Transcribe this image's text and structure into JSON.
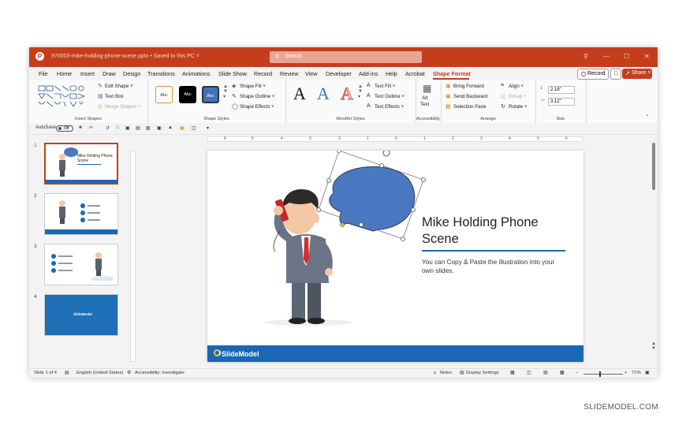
{
  "titlebar": {
    "logo": "P",
    "filename": "970003-mike-holding-phone-scene.pptx • Saved to this PC ˅",
    "search_placeholder": "Search",
    "window_buttons": [
      "⚲",
      "—",
      "☐",
      "✕"
    ]
  },
  "menu": {
    "items": [
      "File",
      "Home",
      "Insert",
      "Draw",
      "Design",
      "Transitions",
      "Animations",
      "Slide Show",
      "Record",
      "Review",
      "View",
      "Developer",
      "Add-ins",
      "Help",
      "Acrobat",
      "Shape Format"
    ],
    "active": "Shape Format",
    "record_label": "Record",
    "share_label": "Share ˅"
  },
  "ribbon": {
    "insert_shapes": {
      "label": "Insert Shapes",
      "edit_shape": "Edit Shape ˅",
      "text_box": "Text Box",
      "merge_shapes": "Merge Shapes ˅"
    },
    "shape_styles": {
      "label": "Shape Styles",
      "swatches": [
        "Abc",
        "Abc",
        "Abc"
      ],
      "shape_fill": "Shape Fill ˅",
      "shape_outline": "Shape Outline ˅",
      "shape_effects": "Shape Effects ˅"
    },
    "wordart": {
      "label": "WordArt Styles",
      "letters": [
        "A",
        "A",
        "A"
      ],
      "text_fill": "Text Fill ˅",
      "text_outline": "Text Outline ˅",
      "text_effects": "Text Effects ˅"
    },
    "accessibility": {
      "label": "Accessibility",
      "alt_text": "Alt\nText"
    },
    "arrange": {
      "label": "Arrange",
      "bring_forward": "Bring Forward",
      "send_backward": "Send Backward",
      "selection_pane": "Selection Pane",
      "align": "Align ˅",
      "group": "Group ˅",
      "rotate": "Rotate ˅"
    },
    "size": {
      "label": "Size",
      "height": "2.18\"",
      "width": "3.12\""
    }
  },
  "qat": {
    "autosave": "AutoSave",
    "toggle": "Off"
  },
  "thumbnails": [
    {
      "num": "1",
      "title": "Mike Holding Phone Scene"
    },
    {
      "num": "2"
    },
    {
      "num": "3"
    },
    {
      "num": "4",
      "brand": "SlideModel"
    }
  ],
  "ruler_marks": [
    "6",
    "5",
    "4",
    "3",
    "2",
    "1",
    "0",
    "1",
    "2",
    "3",
    "4",
    "5",
    "6"
  ],
  "slide": {
    "title": "Mike Holding Phone Scene",
    "body": "You can Copy & Paste the illustration into your own slides.",
    "brand": "SlideModel"
  },
  "statusbar": {
    "slide_of": "Slide 1 of 4",
    "language": "English (United States)",
    "accessibility": "Accessibility: Investigate",
    "notes": "Notes",
    "display_settings": "Display Settings",
    "zoom": "71%"
  },
  "watermark": "SLIDEMODEL.COM",
  "colors": {
    "accent": "#c43e1c",
    "slide_blue": "#1a67b6",
    "bubble": "#4a78c0"
  }
}
